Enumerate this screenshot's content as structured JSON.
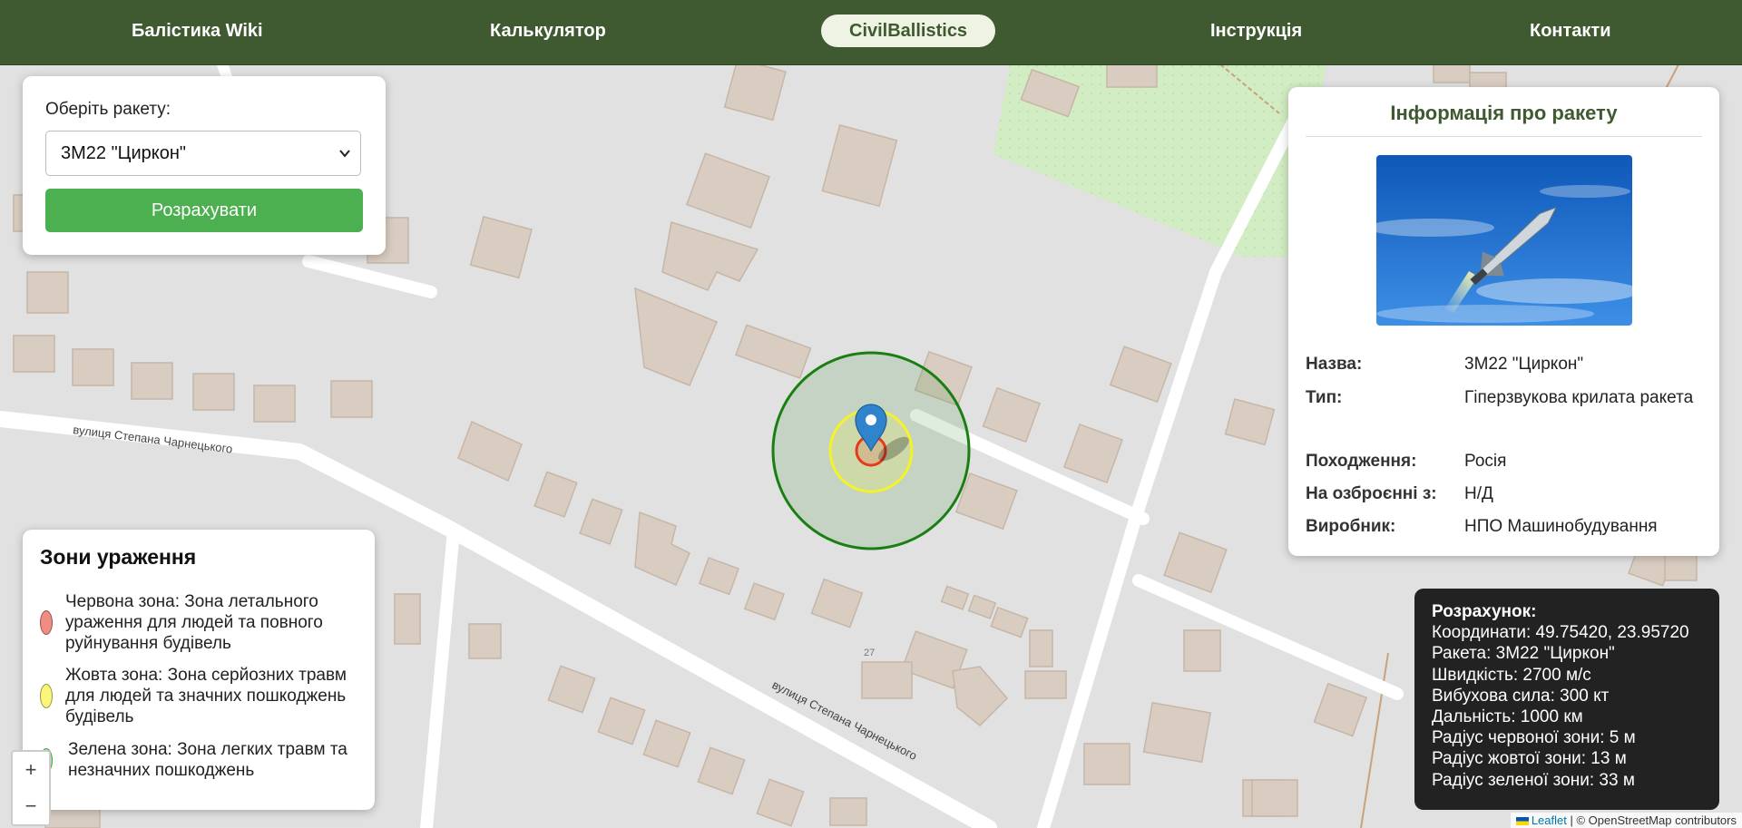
{
  "nav": {
    "items": [
      {
        "label": "Балістика Wiki"
      },
      {
        "label": "Калькулятор"
      },
      {
        "label": "CivilBallistics"
      },
      {
        "label": "Інструкція"
      },
      {
        "label": "Контакти"
      }
    ]
  },
  "selector": {
    "label": "Оберіть ракету:",
    "selected": "3М22 \"Циркон\"",
    "button": "Розрахувати"
  },
  "map": {
    "street_label_1": "вулиця Степана Чарнецького",
    "street_label_2": "вулиця Степана Чарнецького",
    "house_number": "27",
    "zoom_in": "+",
    "zoom_out": "−",
    "attribution_link": "Leaflet",
    "attribution_text": "| © OpenStreetMap contributors"
  },
  "zones_colors": {
    "red": "#e63a1f",
    "yellow": "#f5f22a",
    "green": "#1a7f12"
  },
  "info": {
    "title": "Інформація про ракету",
    "rows": [
      {
        "key": "Назва:",
        "value": "3М22 \"Циркон\""
      },
      {
        "key": "Тип:",
        "value": "Гіперзвукова крилата ракета"
      },
      {
        "key": "Походження:",
        "value": "Росія"
      },
      {
        "key": "На озброєнні з:",
        "value": "Н/Д"
      },
      {
        "key": "Виробник:",
        "value": "НПО Машинобудування"
      }
    ]
  },
  "legend": {
    "title": "Зони ураження",
    "items": [
      {
        "text": "Червона зона: Зона летального ураження для людей та повного руйнування будівель",
        "color": "#f28b82"
      },
      {
        "text": "Жовта зона: Зона серйозних травм для людей та значних пошкоджень будівель",
        "color": "#fbf67a"
      },
      {
        "text": "Зелена зона: Зона легких травм та незначних пошкоджень",
        "color": "#8ef58a"
      }
    ]
  },
  "result": {
    "title": "Розрахунок:",
    "lines": [
      "Координати: 49.75420, 23.95720",
      "Ракета: 3М22 \"Циркон\"",
      "Швидкість: 2700 м/с",
      "Вибухова сила: 300 кт",
      "Дальність: 1000 км",
      "Радіус червоної зони: 5 м",
      "Радіус жовтої зони: 13 м",
      "Радіус зеленої зони: 33 м"
    ]
  }
}
